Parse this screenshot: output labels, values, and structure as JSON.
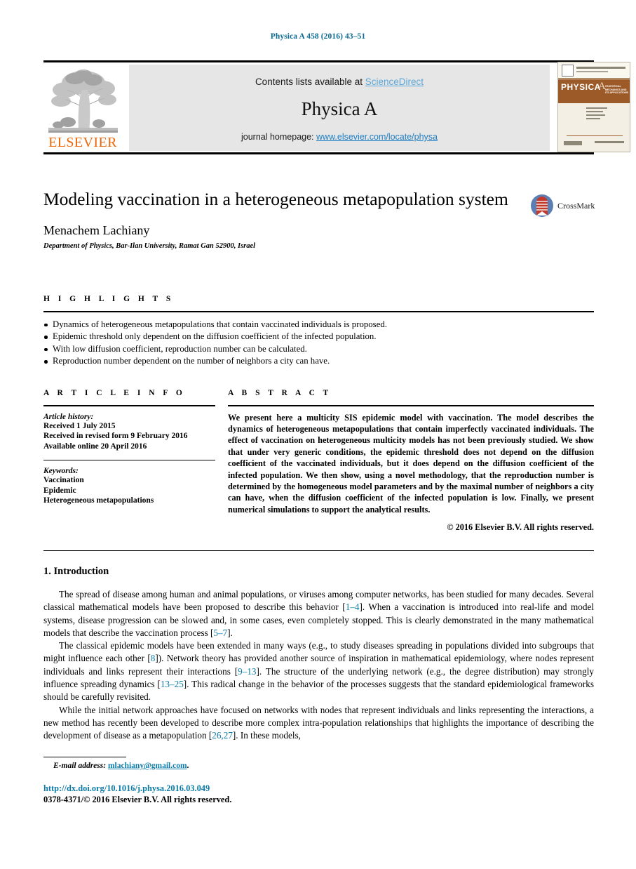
{
  "running_head": "Physica A 458 (2016) 43–51",
  "masthead": {
    "contents_prefix": "Contents lists available at ",
    "sciencedirect_label": "ScienceDirect",
    "journal_title": "Physica A",
    "homepage_prefix": "journal homepage: ",
    "homepage_url": "www.elsevier.com/locate/physa",
    "publisher_name": "ELSEVIER",
    "cover": {
      "banner_title": "PHYSICA",
      "banner_letter": "A",
      "banner_subtitle": "STATISTICAL MECHANICS AND ITS APPLICATIONS"
    },
    "colors": {
      "elsevier_orange": "#eb6608",
      "sciencedirect_blue": "#5aa7d8",
      "homepage_blue": "#1f7fc4",
      "band_grey": "#e6e6e6"
    }
  },
  "article": {
    "title": "Modeling vaccination in a heterogeneous metapopulation system",
    "author": "Menachem Lachiany",
    "affiliation": "Department of Physics, Bar-Ilan University, Ramat Gan 52900, Israel",
    "crossmark_label": "CrossMark"
  },
  "highlights": {
    "heading": "H I G H L I G H T S",
    "items": [
      "Dynamics of heterogeneous metapopulations that contain vaccinated individuals is proposed.",
      "Epidemic threshold only dependent on the diffusion coefficient of the infected population.",
      "With low diffusion coefficient, reproduction number can be calculated.",
      "Reproduction number dependent on the number of neighbors a city can have."
    ]
  },
  "article_info": {
    "heading": "A R T I C L E    I N F O",
    "history_label": "Article history:",
    "history": [
      "Received 1 July 2015",
      "Received in revised form 9 February 2016",
      "Available online 20 April 2016"
    ],
    "keywords_label": "Keywords:",
    "keywords": [
      "Vaccination",
      "Epidemic",
      "Heterogeneous metapopulations"
    ]
  },
  "abstract": {
    "heading": "A B S T R A C T",
    "body": "We present here a multicity SIS epidemic model with vaccination. The model describes the dynamics of heterogeneous metapopulations that contain imperfectly vaccinated individuals. The effect of vaccination on heterogeneous multicity models has not been previously studied. We show that under very generic conditions, the epidemic threshold does not depend on the diffusion coefficient of the vaccinated individuals, but it does depend on the diffusion coefficient of the infected population. We then show, using a novel methodology, that the reproduction number is determined by the homogeneous model parameters and by the maximal number of neighbors a city can have, when the diffusion coefficient of the infected population is low. Finally, we present numerical simulations to support the analytical results.",
    "copyright": "© 2016 Elsevier B.V. All rights reserved."
  },
  "introduction": {
    "heading": "1.  Introduction",
    "paragraphs": [
      {
        "parts": [
          {
            "t": "The spread of disease among human and animal populations, or viruses among computer networks, has been studied for many decades. Several classical mathematical models have been proposed to describe this behavior [",
            "k": "text"
          },
          {
            "t": "1–4",
            "k": "ref"
          },
          {
            "t": "]. When a vaccination is introduced into real-life and model systems, disease progression can be slowed and, in some cases, even completely stopped. This is clearly demonstrated in the many mathematical models that describe the vaccination process [",
            "k": "text"
          },
          {
            "t": "5–7",
            "k": "ref"
          },
          {
            "t": "].",
            "k": "text"
          }
        ]
      },
      {
        "parts": [
          {
            "t": "The classical epidemic models have been extended in many ways (e.g., to study diseases spreading in populations divided into subgroups that might influence each other [",
            "k": "text"
          },
          {
            "t": "8",
            "k": "ref"
          },
          {
            "t": "]). Network theory has provided another source of inspiration in mathematical epidemiology, where nodes represent individuals and links represent their interactions [",
            "k": "text"
          },
          {
            "t": "9–13",
            "k": "ref"
          },
          {
            "t": "]. The structure of the underlying network (e.g., the degree distribution) may strongly influence spreading dynamics [",
            "k": "text"
          },
          {
            "t": "13–25",
            "k": "ref"
          },
          {
            "t": "]. This radical change in the behavior of the processes suggests that the standard epidemiological frameworks should be carefully revisited.",
            "k": "text"
          }
        ]
      },
      {
        "parts": [
          {
            "t": "While the initial network approaches have focused on networks with nodes that represent individuals and links representing the interactions, a new method has recently been developed to describe more complex intra-population relationships that highlights the importance of describing the development of disease as a metapopulation [",
            "k": "text"
          },
          {
            "t": "26,27",
            "k": "ref"
          },
          {
            "t": "]. In these models,",
            "k": "text"
          }
        ]
      }
    ]
  },
  "footer": {
    "email_label": "E-mail address:",
    "email_address": "mlachiany@gmail.com",
    "email_suffix": ".",
    "doi": "http://dx.doi.org/10.1016/j.physa.2016.03.049",
    "issn_line": "0378-4371/© 2016 Elsevier B.V. All rights reserved."
  }
}
